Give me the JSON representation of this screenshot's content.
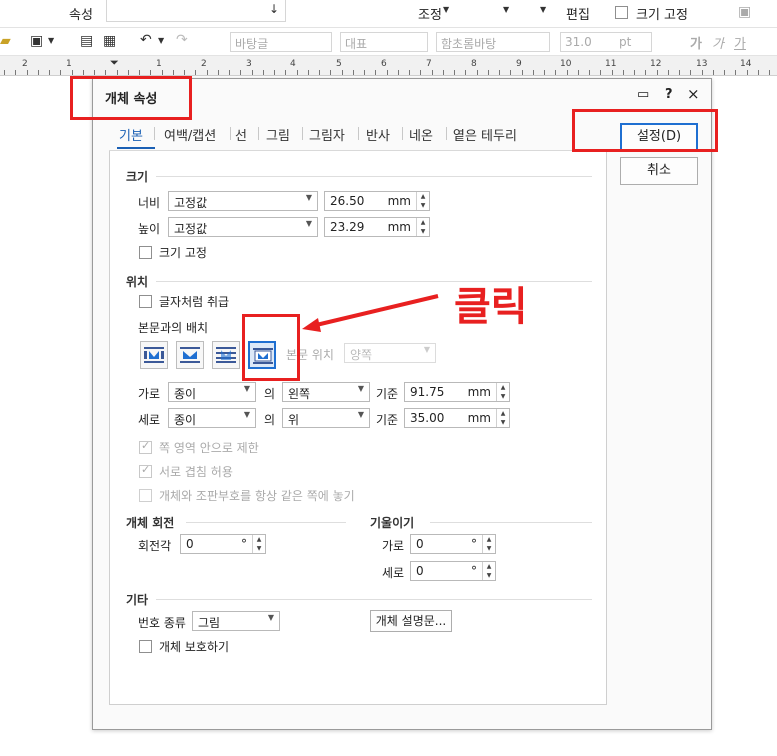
{
  "app_toolbar": {
    "attr_label": "속성",
    "adjust_label": "조정",
    "edit_label": "편집",
    "size_lock_label": "크기 고정",
    "style_field": "바탕글",
    "rep_field": "대표",
    "font_field": "함초롬바탕",
    "font_size": "31.0",
    "font_unit": "pt",
    "bold_glyph": "가",
    "italic_glyph": "가",
    "underline_glyph": "가"
  },
  "ruler": {
    "numbers": [
      "2",
      "1",
      "1",
      "2",
      "3",
      "4",
      "5",
      "6",
      "7",
      "8",
      "9",
      "10",
      "11",
      "12",
      "13",
      "14"
    ]
  },
  "dialog": {
    "title": "개체 속성",
    "help_glyph": "?",
    "close_glyph": "×",
    "tabs": [
      {
        "label": "기본"
      },
      {
        "label": "여백/캡션"
      },
      {
        "label": "선"
      },
      {
        "label": "그림"
      },
      {
        "label": "그림자"
      },
      {
        "label": "반사"
      },
      {
        "label": "네온"
      },
      {
        "label": "옅은 테두리"
      }
    ],
    "ok_button": "설정(D)",
    "cancel_button": "취소",
    "size_section": {
      "title": "크기",
      "width_label": "너비",
      "width_mode": "고정값",
      "width_value": "26.50",
      "height_label": "높이",
      "height_mode": "고정값",
      "height_value": "23.29",
      "unit": "mm",
      "lock_label": "크기 고정"
    },
    "position_section": {
      "title": "위치",
      "treat_as_char_label": "글자처럼 취급",
      "wrap_label": "본문과의 배치",
      "text_pos_label": "본문 위치",
      "text_pos_value": "양쪽",
      "horiz_label": "가로",
      "horiz_ref": "종이",
      "horiz_of": "의",
      "horiz_align": "왼쪽",
      "horiz_base_label": "기준",
      "horiz_value": "91.75",
      "vert_label": "세로",
      "vert_ref": "종이",
      "vert_of": "의",
      "vert_align": "위",
      "vert_base_label": "기준",
      "vert_value": "35.00",
      "unit": "mm",
      "limit_label": "쪽 영역 안으로 제한",
      "overlap_label": "서로 겹침 허용",
      "same_page_label": "개체와 조판부호를 항상 같은 쪽에 놓기"
    },
    "rotation_section": {
      "title": "개체 회전",
      "angle_label": "회전각",
      "angle_value": "0",
      "degree": "°"
    },
    "tilt_section": {
      "title": "기울이기",
      "h_label": "가로",
      "h_value": "0",
      "v_label": "세로",
      "v_value": "0",
      "degree": "°"
    },
    "other_section": {
      "title": "기타",
      "number_type_label": "번호 종류",
      "number_type_value": "그림",
      "desc_button": "개체 설명문...",
      "protect_label": "개체 보호하기"
    }
  },
  "annotation": {
    "text": "클릭",
    "color": "#e82020"
  }
}
